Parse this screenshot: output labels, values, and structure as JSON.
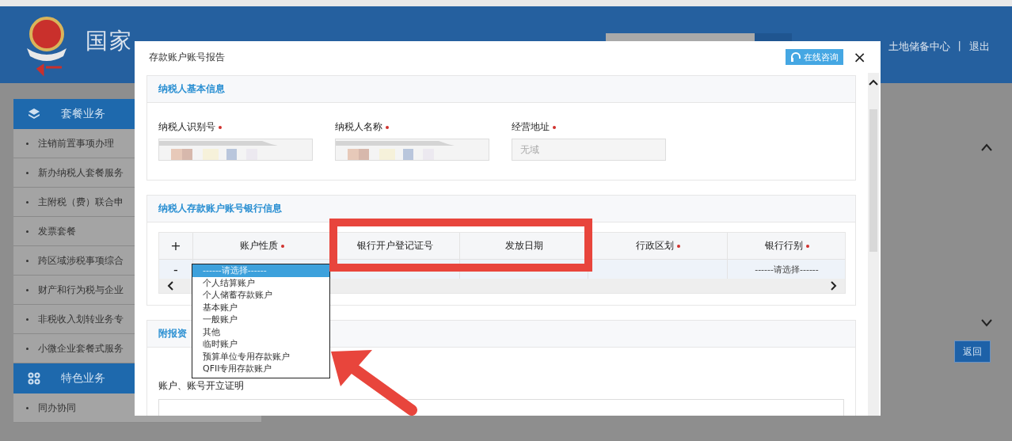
{
  "header": {
    "title": "国家",
    "user": "土地储备中心",
    "separator": "|",
    "logout": "退出"
  },
  "sidebar": {
    "sections": [
      {
        "title": "套餐业务",
        "items": [
          "注销前置事项办理",
          "新办纳税人套餐服务",
          "主附税（费）联合申",
          "发票套餐",
          "跨区域涉税事项综合",
          "财产和行为税与企业",
          "非税收入划转业务专",
          "小微企业套餐式服务"
        ]
      },
      {
        "title": "特色业务",
        "items": [
          "同办协同"
        ]
      }
    ]
  },
  "back_button": "返回",
  "dialog": {
    "title": "存款账户账号报告",
    "help_button": "在线咨询",
    "close": "×",
    "basic": {
      "title": "纳税人基本信息",
      "fields": [
        {
          "label": "纳税人识别号",
          "required": true,
          "redacted": true
        },
        {
          "label": "纳税人名称",
          "required": true,
          "redacted": true
        },
        {
          "label": "经营地址",
          "required": true,
          "placeholder": "无域"
        }
      ]
    },
    "bank": {
      "title": "纳税人存款账户账号银行信息",
      "add": "+",
      "remove": "-",
      "columns": [
        {
          "label": "账户性质",
          "required": true
        },
        {
          "label": "银行开户登记证号",
          "required": false
        },
        {
          "label": "发放日期",
          "required": false
        },
        {
          "label": "行政区划",
          "required": true
        },
        {
          "label": "银行行别",
          "required": true
        }
      ],
      "bank_type_select": "------请选择------",
      "dropdown": [
        {
          "label": "------请选择------",
          "selected": true
        },
        {
          "label": "个人结算账户",
          "selected": false
        },
        {
          "label": "个人储蓄存款账户",
          "selected": false
        },
        {
          "label": "基本账户",
          "selected": false
        },
        {
          "label": "一般账户",
          "selected": false
        },
        {
          "label": "其他",
          "selected": false
        },
        {
          "label": "临时账户",
          "selected": false
        },
        {
          "label": "预算单位专用存款账户",
          "selected": false
        },
        {
          "label": "QFII专用存款账户",
          "selected": false
        }
      ]
    },
    "attach": {
      "title": "附报资",
      "field_label": "账户、账号开立证明"
    }
  }
}
